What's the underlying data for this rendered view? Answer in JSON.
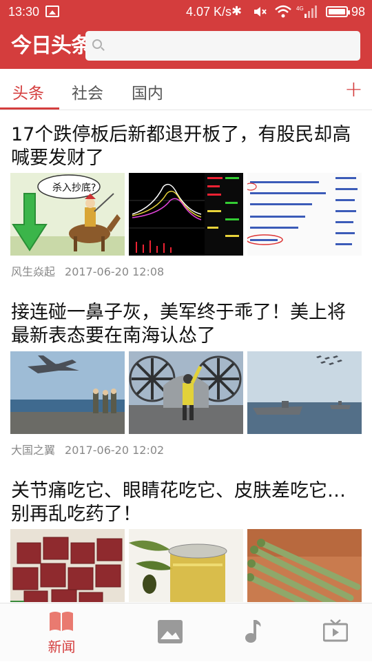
{
  "status_bar": {
    "time": "13:30",
    "net_speed": "4.07 K/s",
    "battery": "98",
    "icons": [
      "image-notification-icon",
      "bluetooth-icon",
      "mute-icon",
      "wifi-icon",
      "signal-4g-icon",
      "battery-icon"
    ]
  },
  "header": {
    "logo": "今日头条",
    "search_placeholder": ""
  },
  "tabs": [
    {
      "label": "头条",
      "active": true
    },
    {
      "label": "社会",
      "active": false
    },
    {
      "label": "国内",
      "active": false
    }
  ],
  "articles": [
    {
      "title": "17个跌停板后新都退开板了，有股民却高喊要发财了",
      "source": "风生焱起",
      "time": "2017-06-20 12:08",
      "thumbs": [
        "cartoon-horse-rider-image",
        "stock-chart-image",
        "stock-comments-image"
      ],
      "thumb_text": [
        "杀入抄底?"
      ]
    },
    {
      "title": "接连碰一鼻子灰，美军终于乖了！美上将最新表态要在南海认怂了",
      "source": "大国之翼",
      "time": "2017-06-20 12:02",
      "thumbs": [
        "jet-takeoff-carrier-image",
        "carrier-deck-crew-image",
        "carrier-fleet-image"
      ]
    },
    {
      "title": "关节痛吃它、眼睛花吃它、皮肤差吃它…别再乱吃药了！",
      "thumbs": [
        "meat-cubes-image",
        "olive-oil-image",
        "asparagus-image"
      ]
    }
  ],
  "bottom_nav": [
    {
      "label": "新闻",
      "icon": "book-icon",
      "active": true
    },
    {
      "label": "",
      "icon": "picture-icon",
      "active": false
    },
    {
      "label": "",
      "icon": "music-icon",
      "active": false
    },
    {
      "label": "",
      "icon": "tv-icon",
      "active": false
    }
  ],
  "colors": {
    "brand_red": "#d43d3d",
    "text": "#111111",
    "meta": "#888888"
  }
}
